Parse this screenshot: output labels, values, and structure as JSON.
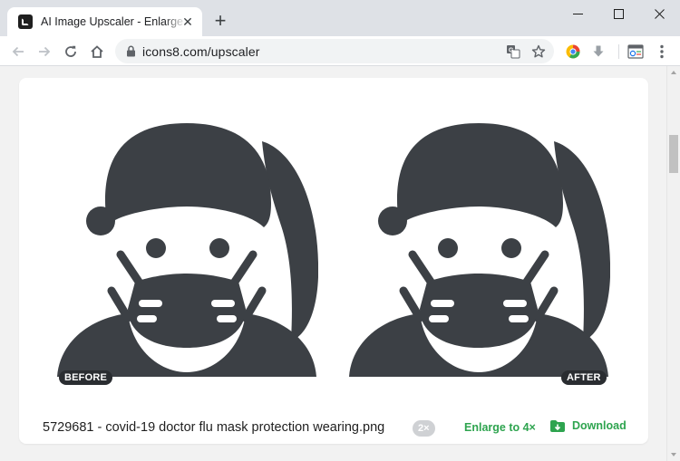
{
  "browser": {
    "tab_title": "AI Image Upscaler - Enlarge Images",
    "url": "icons8.com/upscaler",
    "new_tab_label": "+",
    "tab_close_label": "✕"
  },
  "icons": {
    "favicon": "icons8-logo-icon",
    "translate": "translate-icon",
    "bookmark": "star-icon",
    "extension": "chrome-extension-icon",
    "download": "download-arrow-icon",
    "reader": "webpage-icon",
    "menu": "more-vert-icon"
  },
  "upscaler": {
    "before_label": "BEFORE",
    "after_label": "AFTER",
    "file_name": "5729681 - covid-19 doctor flu mask protection wearing.png",
    "scale_badge": "2×",
    "enlarge_label": "Enlarge to 4×",
    "download_label": "Download"
  },
  "colors": {
    "accent_green": "#2ea44f",
    "icon_dark": "#3c4043",
    "page_bg": "#f2f2f2"
  }
}
